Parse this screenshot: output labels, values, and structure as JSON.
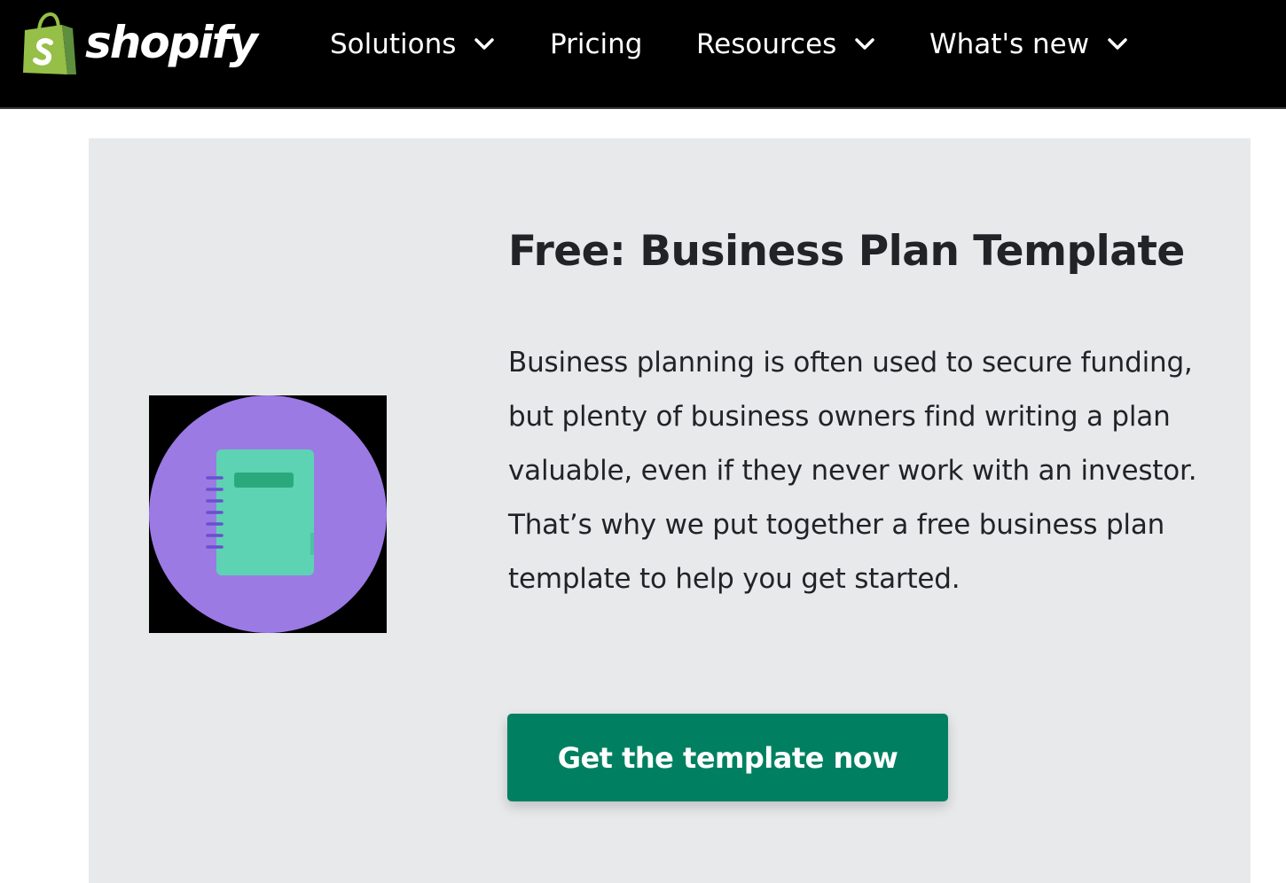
{
  "header": {
    "logo_text": "shopify",
    "logo_icon": "shopping-bag-icon",
    "nav": [
      {
        "label": "Solutions",
        "has_dropdown": true
      },
      {
        "label": "Pricing",
        "has_dropdown": false
      },
      {
        "label": "Resources",
        "has_dropdown": true
      },
      {
        "label": "What's new",
        "has_dropdown": true
      }
    ]
  },
  "promo": {
    "title": "Free: Business Plan Template",
    "body": "Business planning is often used to secure funding, but plenty of business owners find writing a plan valuable, even if they never work with an investor. That’s why we put together a free business plan template to help you get started.",
    "cta_label": "Get the template now",
    "illustration_icon": "notebook-icon"
  },
  "colors": {
    "header_bg": "#000000",
    "card_bg": "#e8e9eb",
    "cta_bg": "#008060",
    "illustration_circle": "#9b7ae4",
    "notebook": "#5dd3b3",
    "notebook_tab": "#2aaa7c",
    "shopify_green": "#95bf47"
  }
}
